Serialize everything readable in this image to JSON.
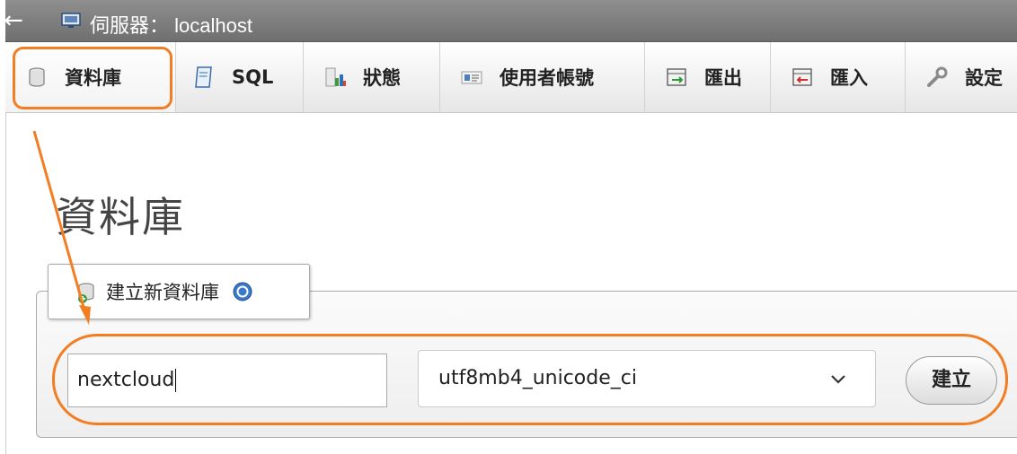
{
  "window": {
    "title": "伺服器： localhost",
    "back_icon": "back-arrow-icon"
  },
  "tabs": [
    {
      "label": "資料庫",
      "icon": "database-icon",
      "active": true
    },
    {
      "label": "SQL",
      "icon": "sql-document-icon",
      "active": false
    },
    {
      "label": "狀態",
      "icon": "status-chart-icon",
      "active": false
    },
    {
      "label": "使用者帳號",
      "icon": "user-accounts-icon",
      "active": false
    },
    {
      "label": "匯出",
      "icon": "export-icon",
      "active": false
    },
    {
      "label": "匯入",
      "icon": "import-icon",
      "active": false
    },
    {
      "label": "設定",
      "icon": "wrench-icon",
      "active": false
    }
  ],
  "main": {
    "page_title": "資料庫",
    "create_db": {
      "legend": "建立新資料庫",
      "db_name_value": "nextcloud",
      "collation_value": "utf8mb4_unicode_ci",
      "create_button": "建立"
    }
  },
  "colors": {
    "title_bar": "#7f7f7f",
    "annotation_orange": "#f27d22"
  }
}
